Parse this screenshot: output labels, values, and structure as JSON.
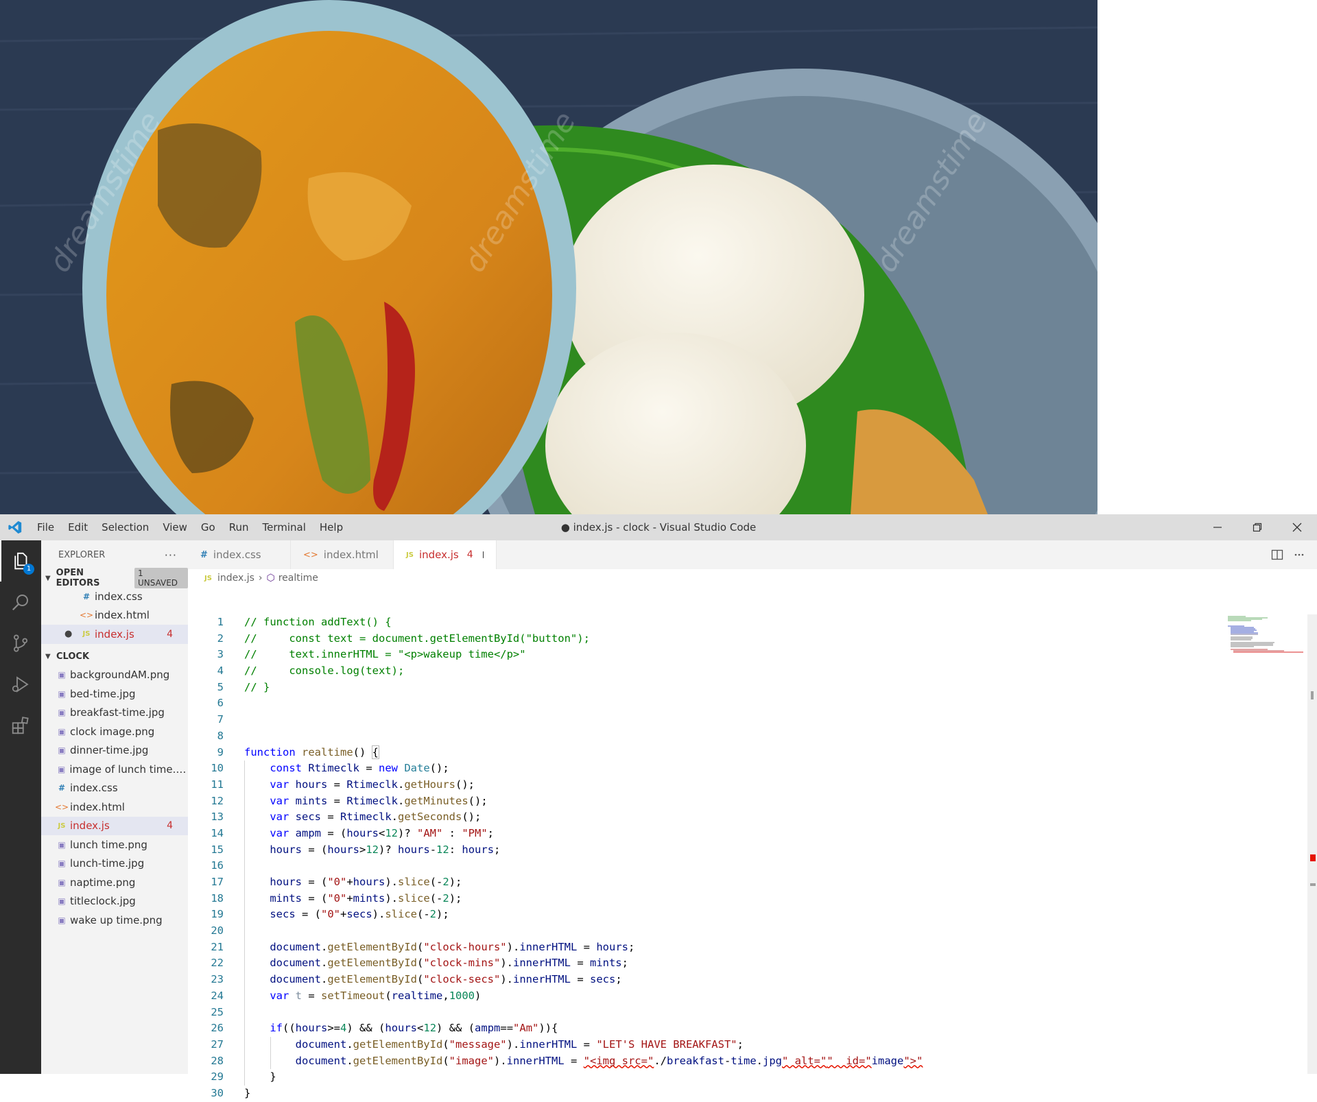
{
  "photo": {
    "watermark": "dreamstime"
  },
  "titlebar": {
    "logo_icon": "vscode-logo-icon",
    "menu": [
      "File",
      "Edit",
      "Selection",
      "View",
      "Go",
      "Run",
      "Terminal",
      "Help"
    ],
    "title": "● index.js - clock - Visual Studio Code"
  },
  "activity": {
    "items": [
      "explorer-icon",
      "search-icon",
      "source-control-icon",
      "run-debug-icon",
      "extensions-icon"
    ],
    "explorer_badge": "1"
  },
  "sidebar": {
    "header": "EXPLORER",
    "more": "···",
    "open_editors": {
      "title": "OPEN EDITORS",
      "badge": "1 UNSAVED",
      "items": [
        {
          "icon": "#",
          "name": "index.css",
          "count": ""
        },
        {
          "icon": "<>",
          "name": "index.html",
          "count": ""
        },
        {
          "icon": "JS",
          "name": "index.js",
          "count": "4"
        }
      ]
    },
    "folder": {
      "title": "CLOCK",
      "items": [
        {
          "icon": "img",
          "name": "backgroundAM.png",
          "count": ""
        },
        {
          "icon": "img",
          "name": "bed-time.jpg",
          "count": ""
        },
        {
          "icon": "img",
          "name": "breakfast-time.jpg",
          "count": ""
        },
        {
          "icon": "img",
          "name": "clock image.png",
          "count": ""
        },
        {
          "icon": "img",
          "name": "dinner-time.jpg",
          "count": ""
        },
        {
          "icon": "img",
          "name": "image of lunch time.p...",
          "count": ""
        },
        {
          "icon": "#",
          "name": "index.css",
          "count": ""
        },
        {
          "icon": "<>",
          "name": "index.html",
          "count": ""
        },
        {
          "icon": "JS",
          "name": "index.js",
          "count": "4"
        },
        {
          "icon": "img",
          "name": "lunch time.png",
          "count": ""
        },
        {
          "icon": "img",
          "name": "lunch-time.jpg",
          "count": ""
        },
        {
          "icon": "img",
          "name": "naptime.png",
          "count": ""
        },
        {
          "icon": "img",
          "name": "titleclock.jpg",
          "count": ""
        },
        {
          "icon": "img",
          "name": "wake up time.png",
          "count": ""
        }
      ]
    }
  },
  "editor": {
    "tabs": [
      {
        "icon": "#",
        "label": "index.css",
        "count": "",
        "dirty": false
      },
      {
        "icon": "<>",
        "label": "index.html",
        "count": "",
        "dirty": false
      },
      {
        "icon": "JS",
        "label": "index.js",
        "count": "4",
        "dirty": true
      }
    ],
    "breadcrumb": {
      "file": "index.js",
      "symbol": "realtime"
    },
    "lines": [
      "// function addText() {",
      "//     const text = document.getElementById(\"button\");",
      "//     text.innerHTML = \"<p>wakeup time</p>\"",
      "//     console.log(text);",
      "// }",
      "",
      "",
      "",
      "function realtime() {",
      "    const Rtimeclk = new Date();",
      "    var hours = Rtimeclk.getHours();",
      "    var mints = Rtimeclk.getMinutes();",
      "    var secs = Rtimeclk.getSeconds();",
      "    var ampm = (hours<12)? \"AM\" : \"PM\";",
      "    hours = (hours>12)? hours-12: hours;",
      "",
      "    hours = (\"0\"+hours).slice(-2);",
      "    mints = (\"0\"+mints).slice(-2);",
      "    secs = (\"0\"+secs).slice(-2);",
      "",
      "    document.getElementById(\"clock-hours\").innerHTML = hours;",
      "    document.getElementById(\"clock-mins\").innerHTML = mints;",
      "    document.getElementById(\"clock-secs\").innerHTML = secs;",
      "    var t = setTimeout(realtime,1000)",
      "",
      "    if((hours>=4) && (hours<12) && (ampm==\"Am\")){",
      "        document.getElementById(\"message\").innerHTML = \"LET'S HAVE BREAKFAST\";",
      "        document.getElementById(\"image\").innerHTML = \"<img src=\"./breakfast-time.jpg\" alt=\"\"  id=\"image\">\"",
      "    }",
      "}"
    ]
  },
  "colors": {
    "activity_bar": "#2c2c2c",
    "sidebar": "#f3f3f3",
    "titlebar": "#dddddd",
    "accent": "#0078d4",
    "error": "#c72e2e"
  }
}
